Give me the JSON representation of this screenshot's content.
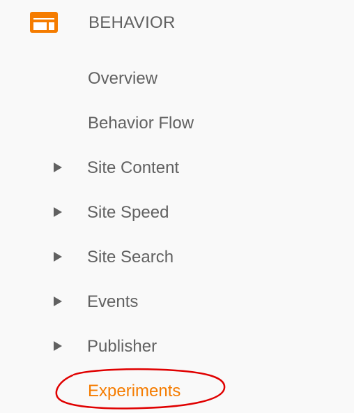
{
  "section": {
    "title": "BEHAVIOR",
    "icon": "behavior-layout-icon",
    "icon_color": "#f57c00"
  },
  "menu": {
    "items": [
      {
        "label": "Overview",
        "expandable": false,
        "active": false
      },
      {
        "label": "Behavior Flow",
        "expandable": false,
        "active": false
      },
      {
        "label": "Site Content",
        "expandable": true,
        "active": false,
        "icon": "caret-right-icon"
      },
      {
        "label": "Site Speed",
        "expandable": true,
        "active": false,
        "icon": "caret-right-icon"
      },
      {
        "label": "Site Search",
        "expandable": true,
        "active": false,
        "icon": "caret-right-icon"
      },
      {
        "label": "Events",
        "expandable": true,
        "active": false,
        "icon": "caret-right-icon"
      },
      {
        "label": "Publisher",
        "expandable": true,
        "active": false,
        "icon": "caret-right-icon"
      },
      {
        "label": "Experiments",
        "expandable": false,
        "active": true
      }
    ]
  },
  "colors": {
    "text": "#616161",
    "accent": "#f57c00",
    "annotation": "#e00000",
    "background": "#f9f9f9"
  },
  "annotation": {
    "shape": "hand-drawn-ellipse",
    "target": "Experiments"
  }
}
